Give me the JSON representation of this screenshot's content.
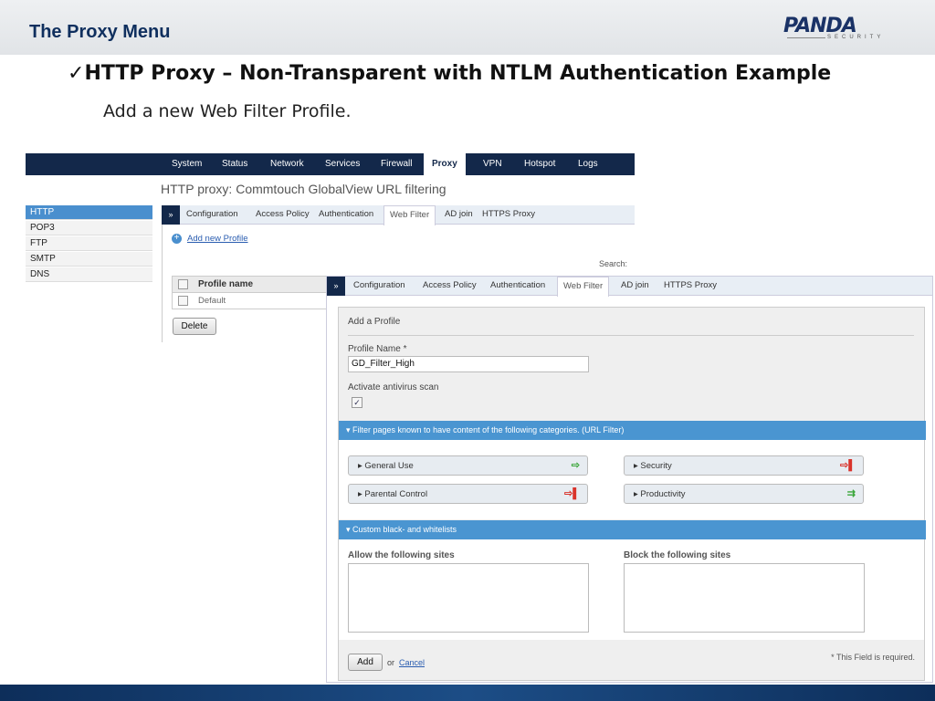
{
  "slide": {
    "title": "The Proxy Menu",
    "heading": "HTTP Proxy – Non-Transparent with NTLM Authentication Example",
    "subtitle": "Add a new Web Filter Profile.",
    "logo_main": "PANDA",
    "logo_sub": "SECURITY",
    "check": "✓"
  },
  "nav": {
    "items": [
      "System",
      "Status",
      "Network",
      "Services",
      "Firewall",
      "Proxy",
      "VPN",
      "Hotspot",
      "Logs"
    ],
    "active": "Proxy"
  },
  "page_heading": "HTTP proxy: Commtouch GlobalView URL filtering",
  "sidebar": [
    "HTTP",
    "POP3",
    "FTP",
    "SMTP",
    "DNS"
  ],
  "tabs": {
    "arrow": "»",
    "items": [
      "Configuration",
      "Access Policy",
      "Authentication",
      "Web Filter",
      "AD join",
      "HTTPS Proxy"
    ],
    "active": "Web Filter"
  },
  "list": {
    "add_link": "Add new Profile",
    "add_icon": "+",
    "search_label": "Search:",
    "col": "Profile name",
    "rows": [
      "Default"
    ],
    "delete": "Delete"
  },
  "form": {
    "section": "Add a Profile",
    "name_label": "Profile Name *",
    "name_value": "GD_Filter_High",
    "av_label": "Activate antivirus scan",
    "av_checked": true,
    "av_mark": "✓",
    "url_header": "▾  Filter pages known to have content of the following categories. (URL Filter)",
    "categories": [
      {
        "name": "▸  General Use",
        "icon": "⇨",
        "color": "#3aa63a"
      },
      {
        "name": "▸  Security",
        "icon": "⇨▌",
        "color": "#d9332b"
      },
      {
        "name": "▸  Parental Control",
        "icon": "⇨▌",
        "color": "#d9332b"
      },
      {
        "name": "▸  Productivity",
        "icon": "⇉",
        "color": "#3aa63a"
      }
    ],
    "lists_header": "▾  Custom black- and whitelists",
    "allow_label": "Allow the following sites",
    "block_label": "Block the following sites",
    "add": "Add",
    "or": "or",
    "cancel": "Cancel",
    "required_note": "* This Field is required."
  }
}
